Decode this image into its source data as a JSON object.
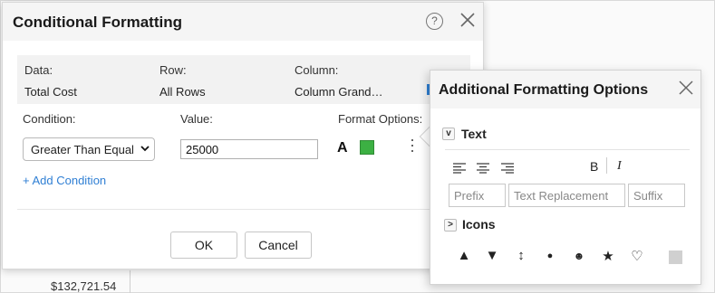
{
  "background": {
    "cell_value": "$132,721.54"
  },
  "dialog": {
    "title": "Conditional Formatting",
    "help_glyph": "?",
    "info": {
      "data_label": "Data:",
      "data_value": "Total Cost",
      "row_label": "Row:",
      "row_value": "All Rows",
      "column_label": "Column:",
      "column_value": "Column Grand…"
    },
    "condition_label": "Condition:",
    "value_label": "Value:",
    "format_options_label": "Format Options:",
    "condition_select": "Greater Than Equal",
    "value_input": "25000",
    "format_text_glyph": "A",
    "format_color": "#3cb043",
    "add_condition": "+ Add Condition",
    "ok_button": "OK",
    "cancel_button": "Cancel"
  },
  "panel": {
    "title": "Additional Formatting Options",
    "text_section": {
      "toggle": "v",
      "label": "Text"
    },
    "bold_glyph": "B",
    "italic_glyph": "I",
    "prefix_placeholder": "Prefix",
    "replacement_placeholder": "Text Replacement",
    "suffix_placeholder": "Suffix",
    "icons_section": {
      "toggle": ">",
      "label": "Icons"
    },
    "icons": {
      "triangle_up": "▲",
      "triangle_down": "▼",
      "updown": "↕",
      "dot": "●",
      "smiley": "☻",
      "star": "★",
      "heart": "♡"
    }
  },
  "colors": {
    "accent_link": "#2f7fd4",
    "format_green": "#3cb043"
  }
}
